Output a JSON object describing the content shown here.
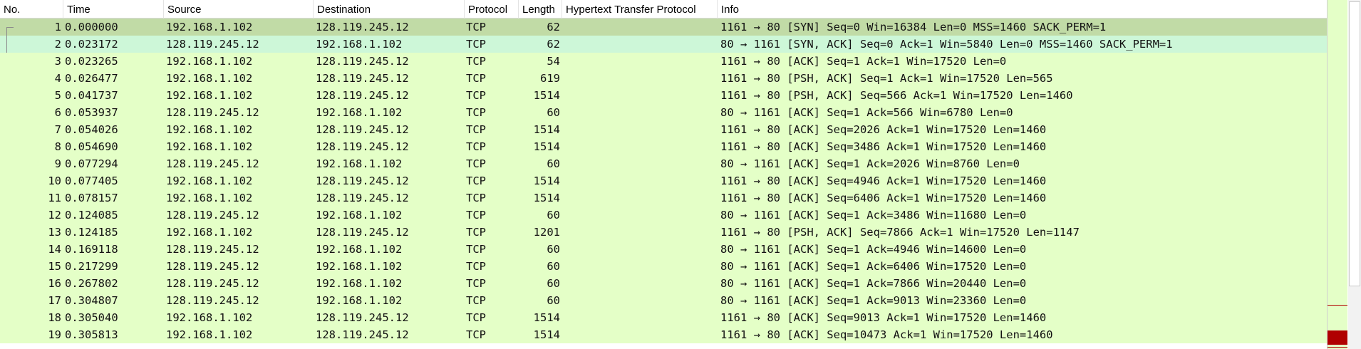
{
  "columns": {
    "no": "No.",
    "time": "Time",
    "source": "Source",
    "destination": "Destination",
    "protocol": "Protocol",
    "length": "Length",
    "http": "Hypertext Transfer Protocol",
    "info": "Info"
  },
  "colors": {
    "row_background": "#e4ffc7",
    "selected_row": "#c1dba6",
    "hover_row": "#cdf7d8",
    "minimap_mark": "#b00000"
  },
  "packets": [
    {
      "no": "1",
      "time": "0.000000",
      "src": "192.168.1.102",
      "dst": "128.119.245.12",
      "proto": "TCP",
      "len": "62",
      "http": "",
      "info": "1161 → 80 [SYN] Seq=0 Win=16384 Len=0 MSS=1460 SACK_PERM=1"
    },
    {
      "no": "2",
      "time": "0.023172",
      "src": "128.119.245.12",
      "dst": "192.168.1.102",
      "proto": "TCP",
      "len": "62",
      "http": "",
      "info": "80 → 1161 [SYN, ACK] Seq=0 Ack=1 Win=5840 Len=0 MSS=1460 SACK_PERM=1"
    },
    {
      "no": "3",
      "time": "0.023265",
      "src": "192.168.1.102",
      "dst": "128.119.245.12",
      "proto": "TCP",
      "len": "54",
      "http": "",
      "info": "1161 → 80 [ACK] Seq=1 Ack=1 Win=17520 Len=0"
    },
    {
      "no": "4",
      "time": "0.026477",
      "src": "192.168.1.102",
      "dst": "128.119.245.12",
      "proto": "TCP",
      "len": "619",
      "http": "",
      "info": "1161 → 80 [PSH, ACK] Seq=1 Ack=1 Win=17520 Len=565"
    },
    {
      "no": "5",
      "time": "0.041737",
      "src": "192.168.1.102",
      "dst": "128.119.245.12",
      "proto": "TCP",
      "len": "1514",
      "http": "",
      "info": "1161 → 80 [PSH, ACK] Seq=566 Ack=1 Win=17520 Len=1460"
    },
    {
      "no": "6",
      "time": "0.053937",
      "src": "128.119.245.12",
      "dst": "192.168.1.102",
      "proto": "TCP",
      "len": "60",
      "http": "",
      "info": "80 → 1161 [ACK] Seq=1 Ack=566 Win=6780 Len=0"
    },
    {
      "no": "7",
      "time": "0.054026",
      "src": "192.168.1.102",
      "dst": "128.119.245.12",
      "proto": "TCP",
      "len": "1514",
      "http": "",
      "info": "1161 → 80 [ACK] Seq=2026 Ack=1 Win=17520 Len=1460"
    },
    {
      "no": "8",
      "time": "0.054690",
      "src": "192.168.1.102",
      "dst": "128.119.245.12",
      "proto": "TCP",
      "len": "1514",
      "http": "",
      "info": "1161 → 80 [ACK] Seq=3486 Ack=1 Win=17520 Len=1460"
    },
    {
      "no": "9",
      "time": "0.077294",
      "src": "128.119.245.12",
      "dst": "192.168.1.102",
      "proto": "TCP",
      "len": "60",
      "http": "",
      "info": "80 → 1161 [ACK] Seq=1 Ack=2026 Win=8760 Len=0"
    },
    {
      "no": "10",
      "time": "0.077405",
      "src": "192.168.1.102",
      "dst": "128.119.245.12",
      "proto": "TCP",
      "len": "1514",
      "http": "",
      "info": "1161 → 80 [ACK] Seq=4946 Ack=1 Win=17520 Len=1460"
    },
    {
      "no": "11",
      "time": "0.078157",
      "src": "192.168.1.102",
      "dst": "128.119.245.12",
      "proto": "TCP",
      "len": "1514",
      "http": "",
      "info": "1161 → 80 [ACK] Seq=6406 Ack=1 Win=17520 Len=1460"
    },
    {
      "no": "12",
      "time": "0.124085",
      "src": "128.119.245.12",
      "dst": "192.168.1.102",
      "proto": "TCP",
      "len": "60",
      "http": "",
      "info": "80 → 1161 [ACK] Seq=1 Ack=3486 Win=11680 Len=0"
    },
    {
      "no": "13",
      "time": "0.124185",
      "src": "192.168.1.102",
      "dst": "128.119.245.12",
      "proto": "TCP",
      "len": "1201",
      "http": "",
      "info": "1161 → 80 [PSH, ACK] Seq=7866 Ack=1 Win=17520 Len=1147"
    },
    {
      "no": "14",
      "time": "0.169118",
      "src": "128.119.245.12",
      "dst": "192.168.1.102",
      "proto": "TCP",
      "len": "60",
      "http": "",
      "info": "80 → 1161 [ACK] Seq=1 Ack=4946 Win=14600 Len=0"
    },
    {
      "no": "15",
      "time": "0.217299",
      "src": "128.119.245.12",
      "dst": "192.168.1.102",
      "proto": "TCP",
      "len": "60",
      "http": "",
      "info": "80 → 1161 [ACK] Seq=1 Ack=6406 Win=17520 Len=0"
    },
    {
      "no": "16",
      "time": "0.267802",
      "src": "128.119.245.12",
      "dst": "192.168.1.102",
      "proto": "TCP",
      "len": "60",
      "http": "",
      "info": "80 → 1161 [ACK] Seq=1 Ack=7866 Win=20440 Len=0"
    },
    {
      "no": "17",
      "time": "0.304807",
      "src": "128.119.245.12",
      "dst": "192.168.1.102",
      "proto": "TCP",
      "len": "60",
      "http": "",
      "info": "80 → 1161 [ACK] Seq=1 Ack=9013 Win=23360 Len=0"
    },
    {
      "no": "18",
      "time": "0.305040",
      "src": "192.168.1.102",
      "dst": "128.119.245.12",
      "proto": "TCP",
      "len": "1514",
      "http": "",
      "info": "1161 → 80 [ACK] Seq=9013 Ack=1 Win=17520 Len=1460"
    },
    {
      "no": "19",
      "time": "0.305813",
      "src": "192.168.1.102",
      "dst": "128.119.245.12",
      "proto": "TCP",
      "len": "1514",
      "http": "",
      "info": "1161 → 80 [ACK] Seq=10473 Ack=1 Win=17520 Len=1460"
    }
  ]
}
